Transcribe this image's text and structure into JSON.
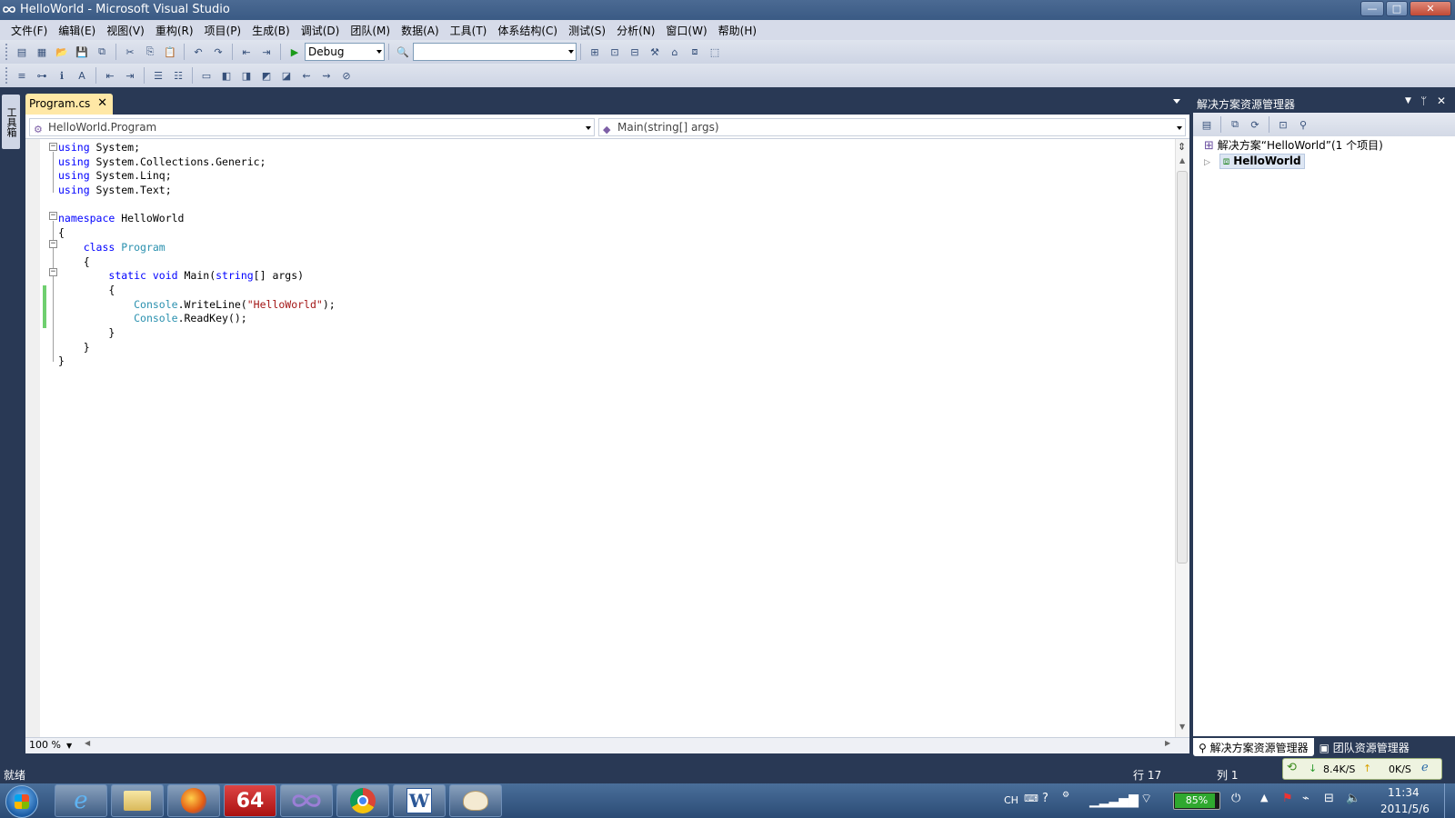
{
  "window": {
    "title": "HelloWorld - Microsoft Visual Studio",
    "min_label": "—",
    "max_label": "□",
    "close_label": "✕",
    "accent": "#293955"
  },
  "menu": [
    "文件(F)",
    "编辑(E)",
    "视图(V)",
    "重构(R)",
    "项目(P)",
    "生成(B)",
    "调试(D)",
    "团队(M)",
    "数据(A)",
    "工具(T)",
    "体系结构(C)",
    "测试(S)",
    "分析(N)",
    "窗口(W)",
    "帮助(H)"
  ],
  "toolbar": {
    "config_value": "Debug",
    "platform_value": ""
  },
  "toolbox": {
    "label": "工具箱"
  },
  "editor": {
    "tab_label": "Program.cs",
    "tab_close": "✕",
    "nav_type": "HelloWorld.Program",
    "nav_member": "Main(string[] args)",
    "zoom": "100 %",
    "code_lines": [
      {
        "parts": [
          {
            "t": "using",
            "c": "kw"
          },
          {
            "t": " System;",
            "c": ""
          }
        ]
      },
      {
        "parts": [
          {
            "t": "using",
            "c": "kw"
          },
          {
            "t": " System.Collections.Generic;",
            "c": ""
          }
        ]
      },
      {
        "parts": [
          {
            "t": "using",
            "c": "kw"
          },
          {
            "t": " System.Linq;",
            "c": ""
          }
        ]
      },
      {
        "parts": [
          {
            "t": "using",
            "c": "kw"
          },
          {
            "t": " System.Text;",
            "c": ""
          }
        ]
      },
      {
        "parts": []
      },
      {
        "parts": [
          {
            "t": "namespace",
            "c": "kw"
          },
          {
            "t": " HelloWorld",
            "c": ""
          }
        ]
      },
      {
        "parts": [
          {
            "t": "{",
            "c": ""
          }
        ]
      },
      {
        "parts": [
          {
            "t": "    ",
            "c": ""
          },
          {
            "t": "class",
            "c": "kw"
          },
          {
            "t": " ",
            "c": ""
          },
          {
            "t": "Program",
            "c": "ty"
          }
        ]
      },
      {
        "parts": [
          {
            "t": "    {",
            "c": ""
          }
        ]
      },
      {
        "parts": [
          {
            "t": "        ",
            "c": ""
          },
          {
            "t": "static",
            "c": "kw"
          },
          {
            "t": " ",
            "c": ""
          },
          {
            "t": "void",
            "c": "kw"
          },
          {
            "t": " Main(",
            "c": ""
          },
          {
            "t": "string",
            "c": "kw"
          },
          {
            "t": "[] args)",
            "c": ""
          }
        ]
      },
      {
        "parts": [
          {
            "t": "        {",
            "c": ""
          }
        ]
      },
      {
        "parts": [
          {
            "t": "            ",
            "c": ""
          },
          {
            "t": "Console",
            "c": "ty"
          },
          {
            "t": ".WriteLine(",
            "c": ""
          },
          {
            "t": "\"HelloWorld\"",
            "c": "st"
          },
          {
            "t": ");",
            "c": ""
          }
        ]
      },
      {
        "parts": [
          {
            "t": "            ",
            "c": ""
          },
          {
            "t": "Console",
            "c": "ty"
          },
          {
            "t": ".ReadKey();",
            "c": ""
          }
        ]
      },
      {
        "parts": [
          {
            "t": "        }",
            "c": ""
          }
        ]
      },
      {
        "parts": [
          {
            "t": "    }",
            "c": ""
          }
        ]
      },
      {
        "parts": [
          {
            "t": "}",
            "c": ""
          }
        ]
      }
    ]
  },
  "solution_explorer": {
    "title": "解决方案资源管理器",
    "pin": "ᛘ",
    "close": "✕",
    "solution_label": "解决方案“HelloWorld”(1 个项目)",
    "project_label": "HelloWorld",
    "tabs": [
      "解决方案资源管理器",
      "团队资源管理器"
    ]
  },
  "status": {
    "ready": "就绪",
    "line": "行 17",
    "col": "列 1"
  },
  "network": {
    "down": "8.4K/S",
    "up": "0K/S"
  },
  "taskbar": {
    "apps": [
      "internet-explorer",
      "file-explorer",
      "firefox",
      "app-64",
      "visual-studio",
      "chrome",
      "word",
      "paint"
    ],
    "app64_label": "64",
    "word_label": "W",
    "lang": "CH",
    "battery": "85%",
    "time": "11:34",
    "date": "2011/5/6"
  }
}
